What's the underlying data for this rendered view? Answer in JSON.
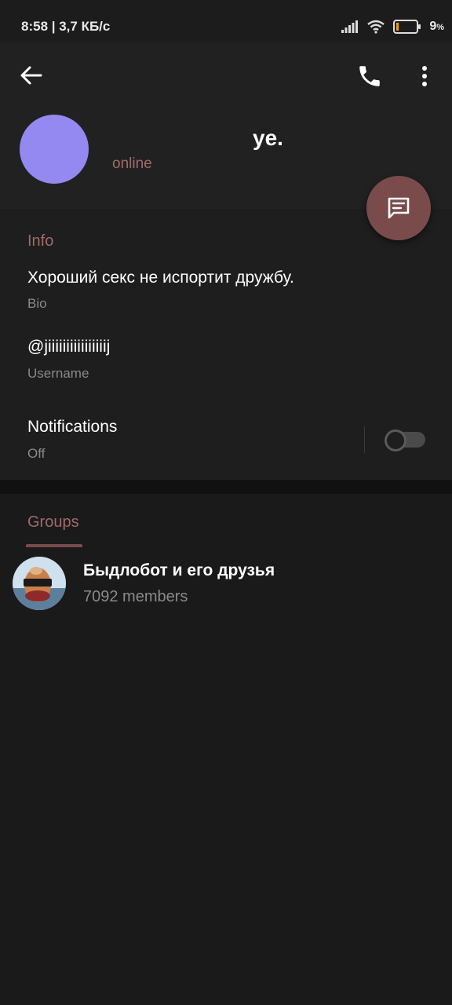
{
  "status_bar": {
    "time": "8:58 | 3,7 КБ/с",
    "battery_level": "9",
    "battery_unit": "%"
  },
  "header": {
    "back_icon": "arrow-left-icon",
    "call_icon": "phone-icon",
    "more_icon": "more-vertical-icon",
    "name": "ye.",
    "status": "online",
    "avatar_color": "#9489f0"
  },
  "fab": {
    "icon": "message-icon",
    "color": "#7a4b4b"
  },
  "info": {
    "title": "Info",
    "bio_value": "Хороший секс не испортит дружбу.",
    "bio_label": "Bio",
    "username_value": "@jiiiiiiiiiiiiiiiij",
    "username_label": "Username",
    "notifications_label": "Notifications",
    "notifications_value": "Off",
    "notifications_enabled": false
  },
  "groups": {
    "title": "Groups",
    "items": [
      {
        "name": "Быдлобот и его друзья",
        "members": "7092 members"
      }
    ]
  },
  "colors": {
    "accent": "#a06a6a",
    "background": "#1a1a1a"
  }
}
